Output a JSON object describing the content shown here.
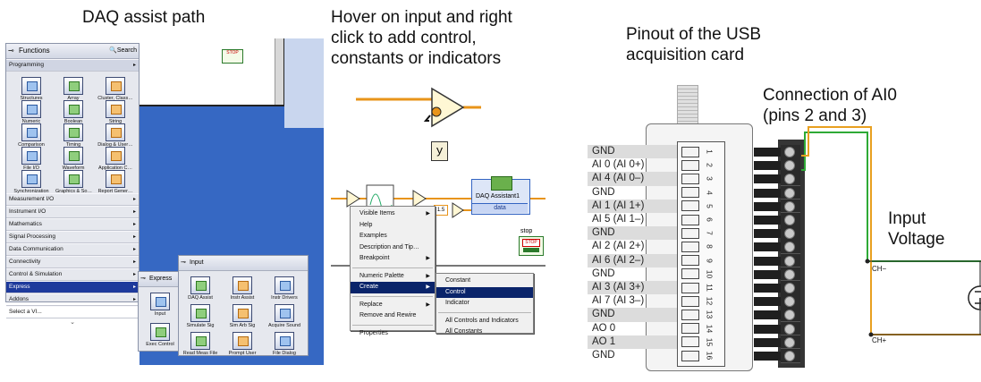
{
  "headings": {
    "daq": "DAQ assist path",
    "hover": "Hover on input and right\nclick to add control,\nconstants or indicators",
    "pinout": "Pinout of the USB\nacquisition card",
    "connection": "Connection of AI0\n(pins 2 and 3)",
    "input_voltage": "Input\nVoltage"
  },
  "functions_palette": {
    "title": "Functions",
    "search": "Search",
    "category": "Programming",
    "icons": [
      {
        "label": "Structures",
        "icon": "structures-icon"
      },
      {
        "label": "Array",
        "icon": "array-icon"
      },
      {
        "label": "Cluster, Class…",
        "icon": "cluster-icon"
      },
      {
        "label": "Numeric",
        "icon": "numeric-icon"
      },
      {
        "label": "Boolean",
        "icon": "boolean-icon"
      },
      {
        "label": "String",
        "icon": "string-icon"
      },
      {
        "label": "Comparison",
        "icon": "comparison-icon"
      },
      {
        "label": "Timing",
        "icon": "timing-icon"
      },
      {
        "label": "Dialog & User…",
        "icon": "dialog-icon"
      },
      {
        "label": "File I/O",
        "icon": "file-io-icon"
      },
      {
        "label": "Waveform",
        "icon": "waveform-icon"
      },
      {
        "label": "Application C…",
        "icon": "application-control-icon"
      },
      {
        "label": "Synchronization",
        "icon": "synchronization-icon"
      },
      {
        "label": "Graphics & So…",
        "icon": "graphics-icon"
      },
      {
        "label": "Report Gener…",
        "icon": "report-icon"
      }
    ],
    "menu": [
      "Measurement I/O",
      "Instrument I/O",
      "Mathematics",
      "Signal Processing",
      "Data Communication",
      "Connectivity",
      "Control & Simulation",
      "Express",
      "Addons",
      "Select a VI..."
    ],
    "selected_menu": "Express"
  },
  "express_palette": {
    "title": "Express",
    "items": [
      {
        "label": "Input",
        "icon": "input-icon"
      },
      {
        "label": "Exec Control",
        "icon": "exec-control-icon"
      }
    ]
  },
  "input_palette": {
    "title": "Input",
    "items": [
      {
        "label": "DAQ Assist",
        "icon": "daq-assist-icon"
      },
      {
        "label": "Instr Assist",
        "icon": "instr-assist-icon"
      },
      {
        "label": "Instr Drivers",
        "icon": "instr-drivers-icon"
      },
      {
        "label": "Simulate Sig",
        "icon": "simulate-signal-icon"
      },
      {
        "label": "Sim Arb Sig",
        "icon": "sim-arb-signal-icon"
      },
      {
        "label": "Acquire Sound",
        "icon": "acquire-sound-icon"
      },
      {
        "label": "Read Meas File",
        "icon": "read-meas-file-icon"
      },
      {
        "label": "Prompt User",
        "icon": "prompt-user-icon"
      },
      {
        "label": "File Dialog",
        "icon": "file-dialog-icon"
      }
    ]
  },
  "block_diagram": {
    "stop_label": "STOP",
    "stop_caption": "stop",
    "y_label": "y",
    "daq_assistant_title": "DAQ Assistant1",
    "daq_assistant_terminal": "data",
    "numeric_const": "1.5"
  },
  "context_menu": {
    "items": [
      "Visible Items",
      "Help",
      "Examples",
      "Description and Tip…",
      "Breakpoint",
      "Numeric Palette",
      "Create",
      "Replace",
      "Remove and Rewire",
      "Properties"
    ],
    "selected": "Create"
  },
  "create_submenu": {
    "items": [
      "Constant",
      "Control",
      "Indicator",
      "All Controls and Indicators",
      "All Constants"
    ],
    "selected": "Control"
  },
  "pinout": {
    "labels": [
      "GND",
      "AI 0 (AI 0+)",
      "AI 4 (AI 0–)",
      "GND",
      "AI 1 (AI 1+)",
      "AI 5 (AI 1–)",
      "GND",
      "AI 2 (AI 2+)",
      "AI 6 (AI 2–)",
      "GND",
      "AI 3 (AI 3+)",
      "AI 7 (AI 3–)",
      "GND",
      "AO 0",
      "AO 1",
      "GND"
    ],
    "numbers": [
      "1",
      "2",
      "3",
      "4",
      "5",
      "6",
      "7",
      "8",
      "9",
      "10",
      "11",
      "12",
      "13",
      "14",
      "15",
      "16"
    ]
  },
  "circuit": {
    "ch_minus": "CH−",
    "ch_plus": "CH+",
    "wire_orange": "#e8a020",
    "wire_green": "#2eaa36"
  },
  "colors": {
    "palette_bg": "#e6e8ee",
    "selection": "#1e3a9c",
    "context_selection": "#0a246a",
    "diagram_blue": "#3364c2",
    "wire_orange": "#e8941a"
  }
}
